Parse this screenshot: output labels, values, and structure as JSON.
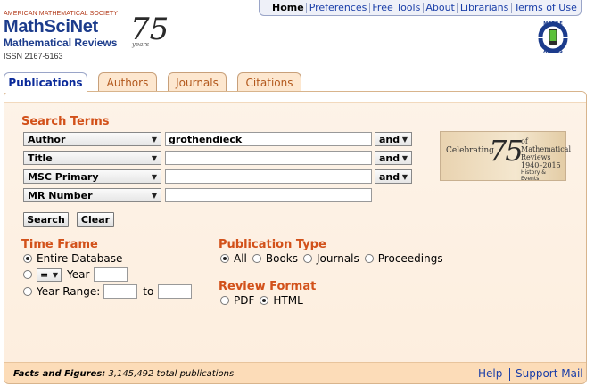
{
  "header": {
    "ams": "AMERICAN MATHEMATICAL SOCIETY",
    "brand": "MathSciNet",
    "subtitle": "Mathematical Reviews",
    "anniversary": "75",
    "issn": "ISSN 2167-5163",
    "mobile_label": "MOBILE ACCESS"
  },
  "topnav": [
    "Home",
    "Preferences",
    "Free Tools",
    "About",
    "Librarians",
    "Terms of Use"
  ],
  "tabs": [
    "Publications",
    "Authors",
    "Journals",
    "Citations"
  ],
  "search": {
    "heading": "Search Terms",
    "rows": [
      {
        "field": "Author",
        "value": "grothendieck",
        "op": "and"
      },
      {
        "field": "Title",
        "value": "",
        "op": "and"
      },
      {
        "field": "MSC Primary",
        "value": "",
        "op": "and"
      },
      {
        "field": "MR Number",
        "value": ""
      }
    ],
    "search_label": "Search",
    "clear_label": "Clear"
  },
  "banner": {
    "celebrating": "Celebrating",
    "number": "75",
    "of": "of Mathematical Reviews",
    "years": "1940–2015",
    "history": "History & Events"
  },
  "time_frame": {
    "heading": "Time Frame",
    "entire": "Entire Database",
    "eq_value": "=",
    "year_label": "Year",
    "year_value": "",
    "range_label": "Year Range:",
    "range_to": "to",
    "range_from_value": "",
    "range_to_value": "",
    "selected": "entire"
  },
  "pub_type": {
    "heading": "Publication Type",
    "options": [
      "All",
      "Books",
      "Journals",
      "Proceedings"
    ],
    "selected": "All"
  },
  "review_format": {
    "heading": "Review Format",
    "options": [
      "PDF",
      "HTML"
    ],
    "selected": "HTML"
  },
  "footer": {
    "facts_label": "Facts and Figures:",
    "facts_value": "3,145,492 total publications",
    "help": "Help",
    "support": "Support Mail"
  },
  "colors": {
    "accent_orange": "#d2511a",
    "link_blue": "#1a3ea8",
    "brand_blue": "#1c3c8c"
  }
}
